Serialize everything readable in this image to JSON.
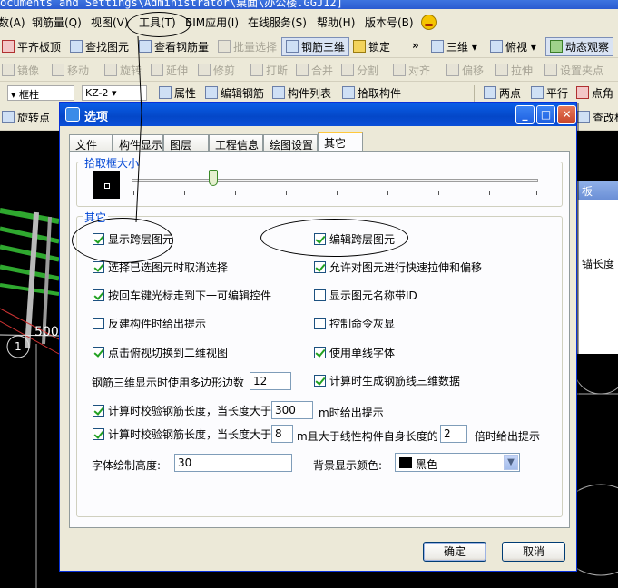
{
  "window": {
    "title": "ocuments and Settings\\Administrator\\桌面\\办公楼.GGJ12]"
  },
  "menubar": {
    "items": [
      "钢筋量(Q)",
      "视图(V)",
      "工具(T)",
      "BIM应用(I)",
      "在线服务(S)",
      "帮助(H)",
      "版本号(B)"
    ],
    "first_partial": "数(A)"
  },
  "toolbar1": {
    "items": [
      "平齐板顶",
      "查找图元",
      "查看钢筋量",
      "批量选择",
      "钢筋三维",
      "锁定"
    ],
    "more": "»",
    "view_3d": "三维",
    "view_top": "俯视",
    "dynamic": "动态观察"
  },
  "toolbar2": {
    "items": [
      "镜像",
      "移动",
      "旋转",
      "延伸",
      "修剪",
      "打断",
      "合并",
      "分割",
      "对齐",
      "偏移",
      "拉伸",
      "设置夹点"
    ]
  },
  "toolbar3": {
    "element_type": "框柱",
    "element_name": "KZ-2",
    "items": [
      "属性",
      "编辑钢筋",
      "构件列表",
      "拾取构件"
    ],
    "draw": [
      "两点",
      "平行",
      "点角"
    ]
  },
  "toolbar4": {
    "left": "旋转点",
    "right": "查改标"
  },
  "canvas": {
    "axis_label": "1",
    "dim_label": "500",
    "panel_header": "板",
    "panel_text": "锚长度"
  },
  "dialog": {
    "title": "选项",
    "tabs": [
      "文件",
      "构件显示",
      "图层",
      "工程信息",
      "绘图设置",
      "其它"
    ],
    "active_tab": "其它",
    "pick_group": {
      "legend": "拾取框大小",
      "slider_position": 0.2
    },
    "other_group": {
      "legend": "其它",
      "checkboxes_left": [
        {
          "label": "显示跨层图元",
          "checked": true
        },
        {
          "label": "选择已选图元时取消选择",
          "checked": true
        },
        {
          "label": "按回车键光标走到下一可编辑控件",
          "checked": true
        },
        {
          "label": "反建构件时给出提示",
          "checked": false
        },
        {
          "label": "点击俯视切换到二维视图",
          "checked": true
        }
      ],
      "checkboxes_right": [
        {
          "label": "编辑跨层图元",
          "checked": true
        },
        {
          "label": "允许对图元进行快速拉伸和偏移",
          "checked": true
        },
        {
          "label": "显示图元名称带ID",
          "checked": false
        },
        {
          "label": "控制命令灰显",
          "checked": false
        },
        {
          "label": "使用单线字体",
          "checked": true
        }
      ],
      "polygon_sides_label": "钢筋三维显示时使用多边形边数",
      "polygon_sides_value": "12",
      "gen_3d_label": "计算时生成钢筋线三维数据",
      "gen_3d_checked": true,
      "check1": {
        "prefix": "计算时校验钢筋长度，当长度大于",
        "value": "300",
        "suffix": "m时给出提示",
        "checked": true
      },
      "check2": {
        "prefix": "计算时校验钢筋长度，当长度大于",
        "value": "8",
        "middle": "m且大于线性构件自身长度的",
        "value2": "2",
        "suffix": "倍时给出提示",
        "checked": true
      },
      "font_height_label": "字体绘制高度:",
      "font_height_value": "30",
      "bg_color_label": "背景显示颜色:",
      "bg_color_value": "黑色"
    },
    "ok": "确定",
    "cancel": "取消"
  }
}
